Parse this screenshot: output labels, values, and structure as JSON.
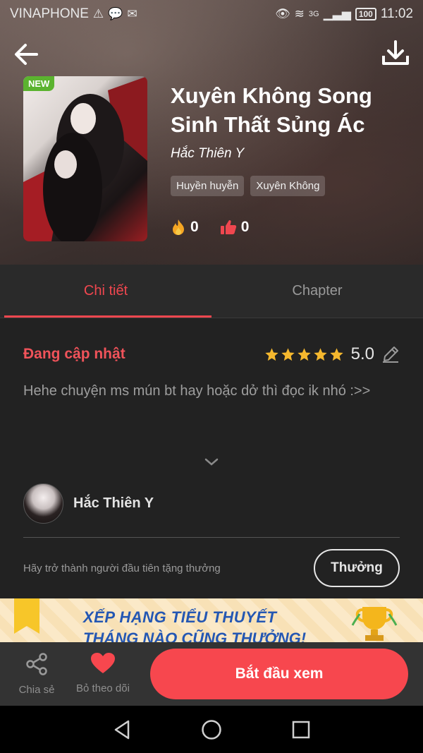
{
  "status_bar": {
    "carrier": "VINAPHONE",
    "network": "3G",
    "battery": "100",
    "time": "11:02"
  },
  "book": {
    "badge": "NEW",
    "title": "Xuyên Không Song Sinh Thất Sủng Ác",
    "author": "Hắc Thiên Y",
    "tags": [
      "Huyền huyễn",
      "Xuyên Không"
    ],
    "fire_count": "0",
    "like_count": "0"
  },
  "tabs": [
    {
      "label": "Chi tiết",
      "active": true
    },
    {
      "label": "Chapter",
      "active": false
    }
  ],
  "detail": {
    "status": "Đang cập nhật",
    "rating": "5.0",
    "stars": 5,
    "description": "Hehe chuyện ms mún bt hay hoặc dở thì đọc ik nhó :>>"
  },
  "author_row": {
    "name": "Hắc Thiên Y"
  },
  "reward": {
    "text": "Hãy trở thành người đầu tiên tặng thưởng",
    "button": "Thưởng"
  },
  "banner": {
    "line1": "XẾP HẠNG TIỂU THUYẾT",
    "line2": "THÁNG NÀO CŨNG THƯỞNG!"
  },
  "actions": {
    "share_label": "Chia sẻ",
    "unfollow_label": "Bỏ theo dõi",
    "start_label": "Bắt đầu xem"
  },
  "colors": {
    "accent": "#f7474e",
    "status_text": "#f0535a",
    "star": "#f5b82e"
  }
}
